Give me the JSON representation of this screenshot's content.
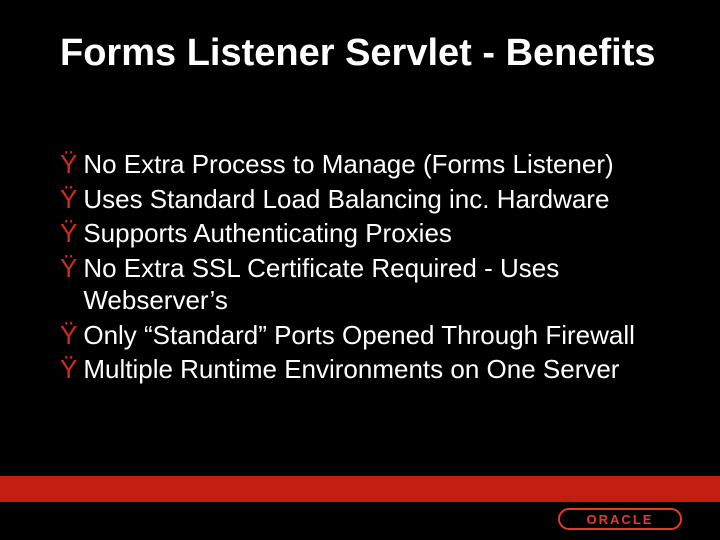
{
  "title": "Forms Listener Servlet - Benefits",
  "bullets": [
    {
      "mark": "Ÿ",
      "text": "No Extra Process to Manage (Forms Listener)"
    },
    {
      "mark": "Ÿ",
      "text": "Uses Standard Load Balancing inc. Hardware"
    },
    {
      "mark": "Ÿ",
      "text": "Supports Authenticating Proxies"
    },
    {
      "mark": "Ÿ",
      "text": " No Extra SSL Certificate Required - Uses Webserver’s"
    },
    {
      "mark": "Ÿ",
      "text": "Only “Standard” Ports Opened Through Firewall"
    },
    {
      "mark": "Ÿ",
      "text": "Multiple Runtime Environments on One Server"
    }
  ],
  "logo_text": "ORACLE",
  "colors": {
    "background": "#000000",
    "text": "#ffffff",
    "accent": "#c41e13",
    "bullet": "#d62b1a",
    "logo": "#e43a2a"
  }
}
